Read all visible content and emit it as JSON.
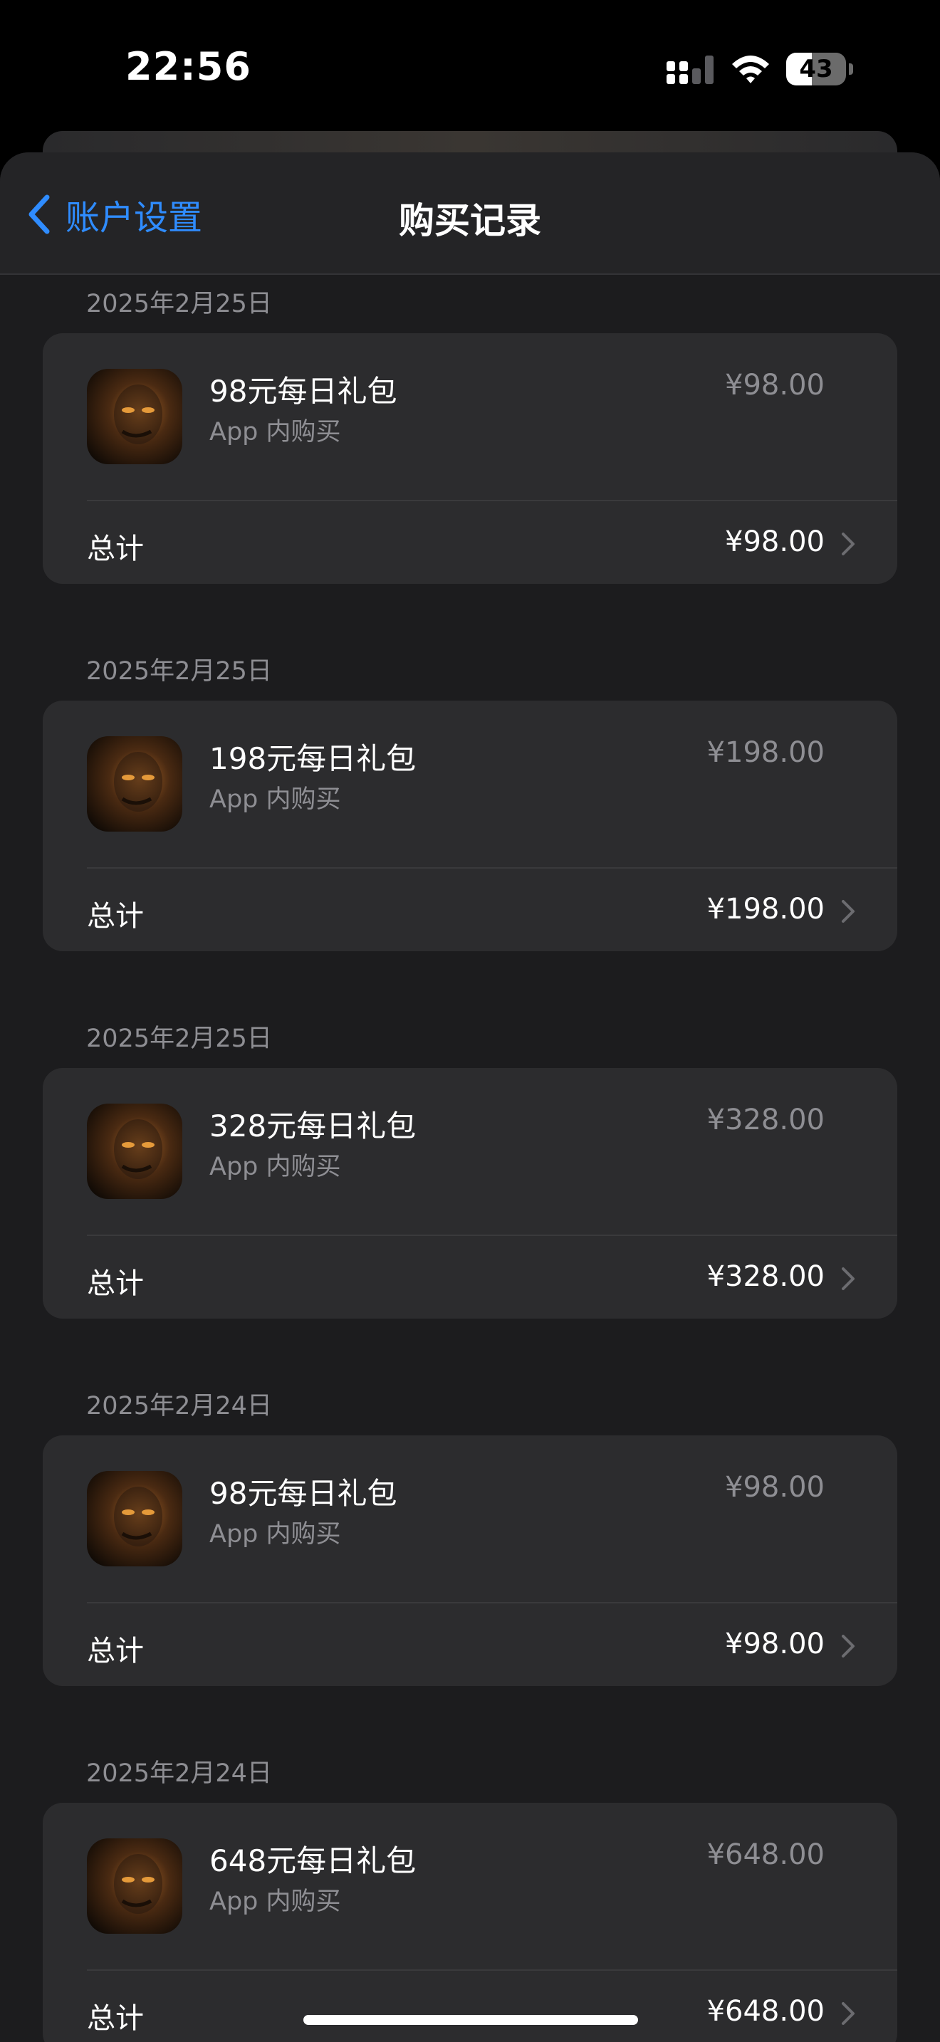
{
  "status_bar": {
    "time": "22:56",
    "battery": "43",
    "battery_level": 0.43
  },
  "nav": {
    "back_label": "账户设置",
    "title": "购买记录"
  },
  "purchases": [
    {
      "date": "2025年2月25日",
      "name": "98元每日礼包",
      "type": "App 内购买",
      "price": "¥98.00",
      "total_label": "总计",
      "total": "¥98.00"
    },
    {
      "date": "2025年2月25日",
      "name": "198元每日礼包",
      "type": "App 内购买",
      "price": "¥198.00",
      "total_label": "总计",
      "total": "¥198.00"
    },
    {
      "date": "2025年2月25日",
      "name": "328元每日礼包",
      "type": "App 内购买",
      "price": "¥328.00",
      "total_label": "总计",
      "total": "¥328.00"
    },
    {
      "date": "2025年2月24日",
      "name": "98元每日礼包",
      "type": "App 内购买",
      "price": "¥98.00",
      "total_label": "总计",
      "total": "¥98.00"
    },
    {
      "date": "2025年2月24日",
      "name": "648元每日礼包",
      "type": "App 内购买",
      "price": "¥648.00",
      "total_label": "总计",
      "total": "¥648.00"
    }
  ],
  "colors": {
    "accent": "#2f8cff",
    "background": "#1c1c1e",
    "card": "#2c2c2e",
    "secondary_text": "#8e8e93"
  },
  "icons": {
    "back": "chevron-left-icon",
    "row": "chevron-right-icon",
    "app": "app-icon"
  }
}
